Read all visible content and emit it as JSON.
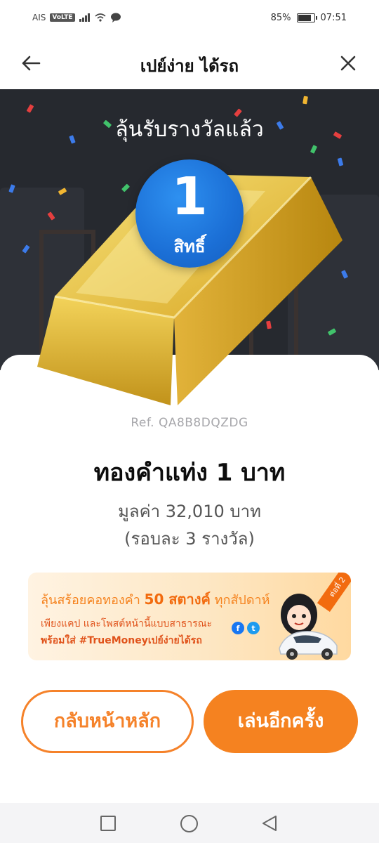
{
  "status_bar": {
    "carrier": "AIS",
    "volte": "VoLTE",
    "battery_text": "85%",
    "battery_level": 0.85,
    "time": "07:51"
  },
  "header": {
    "title": "เปย์ง่าย ได้รถ",
    "back_icon": "arrow-left-icon",
    "close_icon": "close-icon"
  },
  "prize": {
    "headline": "ลุ้นรับรางวัลแล้ว",
    "count": "1",
    "count_label": "สิทธิ์",
    "ref": "Ref. QA8B8DQZDG",
    "name": "ทองคำแท่ง 1 บาท",
    "value": "มูลค่า 32,010 บาท",
    "limit": "(รอบละ 3 รางวัล)"
  },
  "promo": {
    "line1_prefix": "ลุ้นสร้อยคอทองคำ ",
    "line1_highlight": "50 สตางค์",
    "line1_suffix": " ทุกสัปดาห์",
    "line2": "เพียงแคป และโพสต์หน้านี้แบบสาธารณะ",
    "line3": "พร้อมใส่ #TrueMoneyเปย์ง่ายได้รถ",
    "tag": "ต่อที่ 2",
    "facebook_glyph": "f",
    "twitter_glyph": "t"
  },
  "buttons": {
    "home_label": "กลับหน้าหลัก",
    "replay_label": "เล่นอีกครั้ง"
  },
  "colors": {
    "accent": "#f58220",
    "badge_blue": "#1b6fd6",
    "dark_bg": "#26292f",
    "gold": "#e2b62c"
  }
}
